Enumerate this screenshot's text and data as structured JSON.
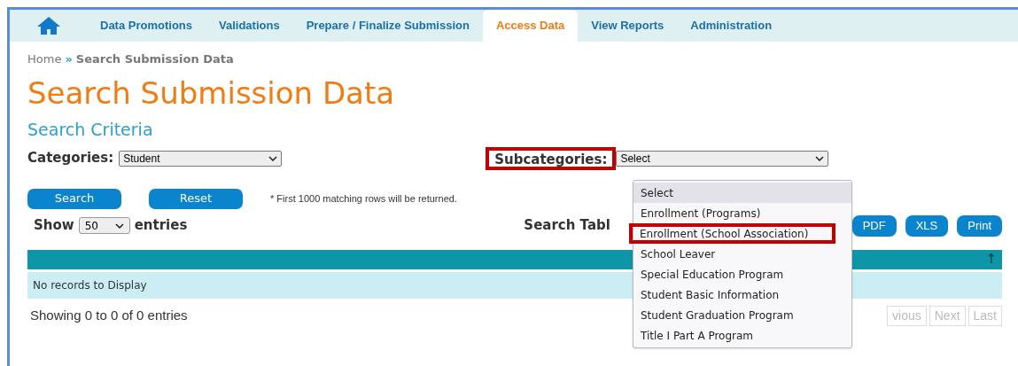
{
  "nav": {
    "tabs": [
      {
        "label": "Data Promotions",
        "selected": false
      },
      {
        "label": "Validations",
        "selected": false
      },
      {
        "label": "Prepare / Finalize Submission",
        "selected": false
      },
      {
        "label": "Access Data",
        "selected": true
      },
      {
        "label": "View Reports",
        "selected": false
      },
      {
        "label": "Administration",
        "selected": false
      }
    ]
  },
  "breadcrumb": {
    "home": "Home",
    "separator": "»",
    "current": "Search Submission Data"
  },
  "title": "Search Submission Data",
  "section_title": "Search Criteria",
  "categories": {
    "label": "Categories:",
    "value": "Student"
  },
  "subcategories": {
    "label": "Subcategories:",
    "value": "Select",
    "label_marked": true,
    "options": [
      {
        "label": "Select",
        "selected": true,
        "marked": false
      },
      {
        "label": "Enrollment (Programs)",
        "selected": false,
        "marked": false
      },
      {
        "label": "Enrollment (School Association)",
        "selected": false,
        "marked": true
      },
      {
        "label": "School Leaver",
        "selected": false,
        "marked": false
      },
      {
        "label": "Special Education Program",
        "selected": false,
        "marked": false
      },
      {
        "label": "Student Basic Information",
        "selected": false,
        "marked": false
      },
      {
        "label": "Student Graduation Program",
        "selected": false,
        "marked": false
      },
      {
        "label": "Title I Part A Program",
        "selected": false,
        "marked": false
      }
    ]
  },
  "buttons": [
    "Search",
    "Reset"
  ],
  "note": "* First 1000 matching rows will be returned.",
  "show": {
    "before": "Show",
    "value": "50",
    "after": "entries"
  },
  "search_table_label": "Search Tabl",
  "export_buttons": [
    "PDF",
    "XLS",
    "Print"
  ],
  "table": {
    "sort_icon": "↑",
    "empty_text": "No records to Display"
  },
  "summary": "Showing 0 to 0 of 0 entries",
  "pagination": [
    "vious",
    "Next",
    "Last"
  ]
}
